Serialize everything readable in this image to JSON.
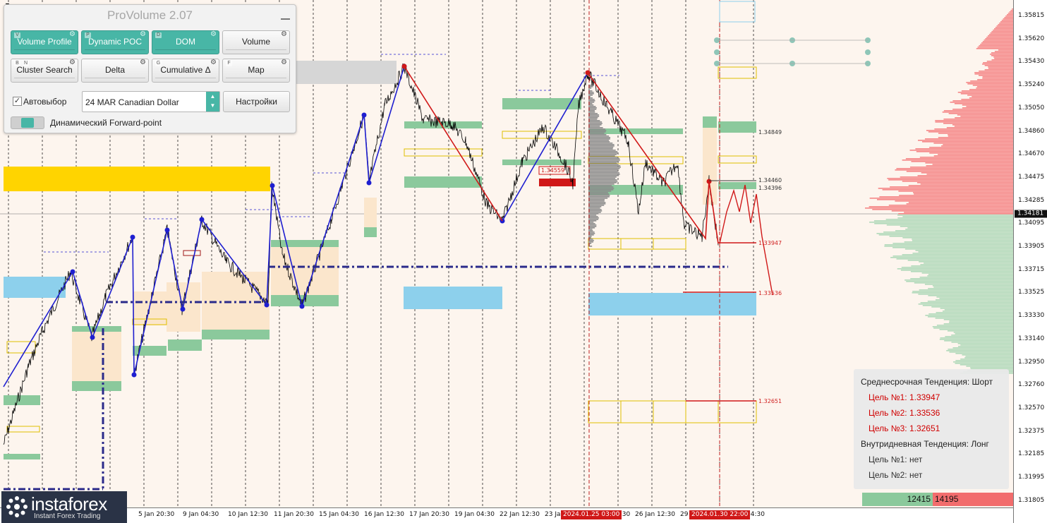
{
  "panel": {
    "title": "ProVolume 2.07",
    "modules": [
      {
        "label": "Volume Profile",
        "keys": [
          "V"
        ],
        "active": true
      },
      {
        "label": "Dynamic POC",
        "keys": [
          "P"
        ],
        "active": true
      },
      {
        "label": "DOM",
        "keys": [
          "D"
        ],
        "active": true
      },
      {
        "label": "Volume",
        "keys": [],
        "active": false
      },
      {
        "label": "Cluster Search",
        "keys": [
          "B",
          "N"
        ],
        "active": false
      },
      {
        "label": "Delta",
        "keys": [],
        "active": false
      },
      {
        "label": "Cumulative Δ",
        "keys": [
          "G"
        ],
        "active": false
      },
      {
        "label": "Map",
        "keys": [
          "F"
        ],
        "active": false
      }
    ],
    "autoselect_label": "Автовыбор",
    "autoselect_checked": true,
    "instrument_value": "24 MAR Canadian Dollar",
    "settings_label": "Настройки",
    "forward_point_label": "Динамический Forward-point"
  },
  "price_scale": {
    "labels": [
      "1.35815",
      "1.35620",
      "1.35430",
      "1.35240",
      "1.35050",
      "1.34860",
      "1.34670",
      "1.34475",
      "1.34285",
      "1.34095",
      "1.33905",
      "1.33715",
      "1.33525",
      "1.33330",
      "1.33140",
      "1.32950",
      "1.32760",
      "1.32570",
      "1.32375",
      "1.32185",
      "1.31995",
      "1.31805"
    ],
    "current_price": "1.34181"
  },
  "time_scale": {
    "labels": [
      "5 Jan 20:30",
      "9 Jan 04:30",
      "10 Jan 12:30",
      "11 Jan 20:30",
      "15 Jan 04:30",
      "16 Jan 12:30",
      "17 Jan 20:30",
      "19 Jan 04:30",
      "22 Jan 12:30",
      "23 Ja",
      "4:30",
      "26 Jan 12:30",
      "29",
      "04:30"
    ],
    "flags": [
      "2024.01.25 03:00",
      "2024.01.30 22:00"
    ]
  },
  "levels": {
    "l1": "1.34849",
    "l2": "1.34460",
    "l3": "1.34396",
    "l4": "1.33947",
    "l5": "1.33536",
    "l6": "1.32651",
    "box_label": "1.34559"
  },
  "info_box": {
    "medium_title": "Среднесрочная Тенденция: Шорт",
    "medium_targets": [
      "Цель №1: 1.33947",
      "Цель №2: 1.33536",
      "Цель №3: 1.32651"
    ],
    "intraday_title": "Внутридневная Тенденция: Лонг",
    "intraday_targets": [
      "Цель №1: нет",
      "Цель №2: нет"
    ]
  },
  "volume_bar": {
    "buy": "12415",
    "sell": "14195"
  },
  "logo": {
    "name": "instaforex",
    "tagline": "Instant Forex Trading"
  },
  "colors": {
    "background": "#fdf5ee",
    "buy_zone": "#8bc99c",
    "sell_zone": "#f26d6d",
    "blue_zone": "#8dd0ec",
    "yellow_zone": "#ffd400",
    "trend_blue": "#1f1fd0",
    "trend_red": "#d01818",
    "accent": "#48b6a6"
  }
}
